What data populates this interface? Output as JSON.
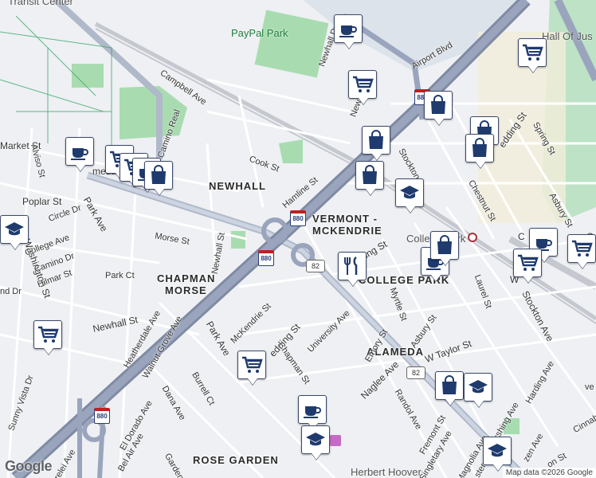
{
  "map": {
    "attribution": "Map data ©2026 Google",
    "logo": "Google"
  },
  "highways": {
    "i880_a": "880",
    "i880_b": "880",
    "i880_c": "880",
    "i880_d": "880",
    "sr82_a": "82",
    "sr82_b": "82"
  },
  "areas": {
    "newhall": "NEWHALL",
    "vermont1": "VERMONT -",
    "vermont2": "MCKENDRIE",
    "chapman1": "CHAPMAN",
    "chapman2": "MORSE",
    "college_park": "COLLEGE PARK",
    "alameda": "ALAMEDA",
    "rose_garden": "ROSE GARDEN"
  },
  "pois": {
    "transit_center": "Transit Center",
    "paypal_park": "PayPal Park",
    "hall_of_justice": "Hall Of Jus",
    "college_park_station": "College Park",
    "herbert_hoover": "Herbert Hoover"
  },
  "streets": {
    "airport_blvd": "Airport Blvd",
    "campbell": "Campbell Ave",
    "el_camino": "El Camino Real",
    "market": "Market St",
    "alviso": "Alviso St",
    "alameda_frag": "meda",
    "poplar": "Poplar St",
    "park_ave_top": "Park Ave",
    "circle_dr": "Circle Dr",
    "college_ave": "College Ave",
    "washington": "Washington St",
    "camino_dr": "Camino Dr",
    "hilmar": "Hilmar St",
    "nd_dr": "nd Dr",
    "park_ct": "Park Ct",
    "newhall_st": "Newhall St",
    "heatherdale": "Heatherdale Ave",
    "walnut_grove": "Walnut Grove Ave",
    "sunny_vista": "Sunny Vista Dr",
    "morse": "Morse St",
    "newhall_st_v": "Newhall St",
    "cook": "Cook St",
    "hamline": "Hamline St",
    "newhall_dr": "Newhall Dr",
    "new_frag": "New",
    "stockton_top": "Stockton",
    "chestnut": "Chestnut St",
    "spring": "Spring St",
    "asbury_top": "Asbury St",
    "edding_top": "edding St",
    "ing_st": "ing St",
    "laurel": "Laurel St",
    "myrtle": "Myrtle St",
    "asbury_mid": "Asbury St",
    "stockton_ave": "Stockton Ave",
    "w_frag": "W",
    "emory": "Emory St",
    "university": "University Ave",
    "w_taylor": "W Taylor St",
    "naglee": "Naglee Ave",
    "harding": "Harding Ave",
    "mckendrie": "McKendrie St",
    "edding_mid": "edding St",
    "chapman_st": "Chapman St",
    "park_ave": "Park Ave",
    "burrell": "Burrell Ct",
    "dana": "Dana Ave",
    "el_dorado": "El Dorado Ave",
    "bel_air": "Bel Air Ave",
    "garden_frag": "Garden",
    "urelei": "urelei Ave",
    "randol": "Randol Ave",
    "fremont": "Fremont St",
    "singletary": "Singletary Ave",
    "magnolia": "Magnolia Ave",
    "pershing": "Pershing Ave",
    "ster_av": "ster Av",
    "zen_ave": "zen Ave",
    "on_st": "on St",
    "cinnab": "Cinnab",
    "c_frag": "C",
    "c_frag2": "C",
    "ve_frag": "ve"
  },
  "markers": [
    {
      "type": "cafe",
      "icon": "coffee-cup-icon"
    },
    {
      "type": "shop",
      "icon": "shopping-cart-icon"
    },
    {
      "type": "shop",
      "icon": "shopping-cart-icon"
    },
    {
      "type": "store",
      "icon": "shopping-bag-icon"
    },
    {
      "type": "store",
      "icon": "shopping-bag-icon"
    },
    {
      "type": "store",
      "icon": "shopping-bag-icon"
    },
    {
      "type": "store",
      "icon": "shopping-bag-icon"
    },
    {
      "type": "store",
      "icon": "shopping-bag-icon"
    },
    {
      "type": "school",
      "icon": "graduation-cap-icon"
    },
    {
      "type": "cafe",
      "icon": "coffee-cup-icon"
    },
    {
      "type": "shop",
      "icon": "shopping-cart-icon"
    },
    {
      "type": "shop",
      "icon": "shopping-cart-icon"
    },
    {
      "type": "cafe",
      "icon": "coffee-cup-icon"
    },
    {
      "type": "store",
      "icon": "shopping-bag-icon"
    },
    {
      "type": "restaurant",
      "icon": "fork-knife-icon"
    },
    {
      "type": "cafe",
      "icon": "coffee-cup-icon"
    },
    {
      "type": "school",
      "icon": "graduation-cap-icon"
    },
    {
      "type": "shop",
      "icon": "shopping-cart-icon"
    },
    {
      "type": "shop",
      "icon": "shopping-cart-icon"
    },
    {
      "type": "cafe",
      "icon": "coffee-cup-icon"
    },
    {
      "type": "school",
      "icon": "graduation-cap-icon"
    },
    {
      "type": "store",
      "icon": "shopping-bag-icon"
    },
    {
      "type": "school",
      "icon": "graduation-cap-icon"
    },
    {
      "type": "school",
      "icon": "graduation-cap-icon"
    },
    {
      "type": "store",
      "icon": "shopping-bag-icon"
    },
    {
      "type": "cafe",
      "icon": "coffee-cup-icon"
    }
  ],
  "colors": {
    "freeway": "#8f9bb3",
    "park": "#a8dcb0",
    "water": "#d9e6f2",
    "pin_border": "#3c4a6b"
  }
}
